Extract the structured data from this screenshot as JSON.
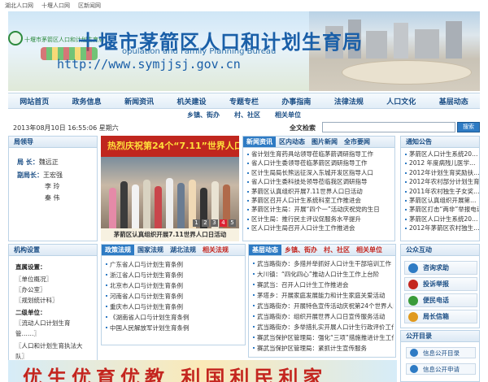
{
  "top_links": [
    "湖北人口网",
    "十堰人口网",
    "区新闻网"
  ],
  "banner": {
    "small_title": "十堰市茅箭区人口和计划生育局",
    "title": "十堰市茅箭区人口和计划生育局",
    "en_title": "opulation and Family Planning Bureau",
    "url": "http://www.symjjsj.gov.cn"
  },
  "nav": [
    "网站首页",
    "政务信息",
    "新闻资讯",
    "机关建设",
    "专题专栏",
    "办事指南",
    "法律法规",
    "人口文化",
    "基层动态"
  ],
  "subnav": [
    "乡镇、街办",
    "村、社区",
    "相关单位"
  ],
  "datebar": {
    "date": "2013年08月10日  16:55:06  星期六",
    "search_label": "全文检索",
    "search_value": "",
    "search_button": "搜索"
  },
  "leaders": {
    "heading": "局领导",
    "rows": [
      {
        "role": "局    长：",
        "name": "魏远正"
      },
      {
        "role": "副局长：",
        "name": "王宏强"
      },
      {
        "role": "",
        "name": "李    玲"
      },
      {
        "role": "",
        "name": "秦    伟"
      }
    ]
  },
  "institutions": {
    "heading": "机构设置",
    "lines": [
      "直属设置：",
      "〖单位概况〗",
      "〖办公室〗",
      "〖规划统计科〗",
      "二级单位：",
      "〖流动人口计划生育",
      "管……〗",
      "〖人口和计划生育执法大",
      "队〗"
    ]
  },
  "photo": {
    "banner_text": "热烈庆祝第24个“7.11”世界人口日",
    "caption": "茅箭区认真组织开展7.11世界人口日活动",
    "dots": [
      "1",
      "2",
      "3",
      "4",
      "5"
    ]
  },
  "news": {
    "tabs": [
      "新闻资讯",
      "区内动态",
      "图片新闻",
      "全市要闻"
    ],
    "items": [
      "省计划生育药具站领导莅临茅箭调研指导工作",
      "省人口计生委领导莅临茅箭区调研指导工作",
      "区计生局局长熊远征深入东城开发区指导人口",
      "省人口计生委科技处领导莅临我区调研指导",
      "茅箭区认真组织开展7.11世界人口日活动",
      "茅箭区召开人口计生系统科室工作推进会",
      "茅箭区计生局：开展“四个一”活动庆祝党的生日",
      "区计生局：推行民主评议促服务水平提升",
      "区人口计生局召开人口计生工作推进会"
    ]
  },
  "notice": {
    "heading": "通知公告",
    "items": [
      "茅箭区人口计生系统20…",
      "2012 年度病残儿医学…",
      "2012年计划生育奖励扶…",
      "2012年农村部分计划生育…",
      "2011年农村独生子女奖…",
      "茅箭区认真组织开展第…",
      "茅箭区打击“两非”举报电话",
      "茅箭区人口计生系统20…",
      "2012年茅箭区农村独生…"
    ]
  },
  "laws": {
    "tabs": [
      "政策法规",
      "国家法规",
      "湖北法规",
      "相关法规"
    ],
    "items": [
      "广东省人口与计划生育条例",
      "浙江省人口与计划生育条例",
      "北京市人口与计划生育条例",
      "河南省人口与计划生育条例",
      "重庆市人口与计划生育条例",
      "《湖南省人口与计划生育条例",
      "中国人民解放军计划生育条例"
    ]
  },
  "local": {
    "tabs": [
      "基层动态",
      "乡镇、街办",
      "村、社区",
      "相关单位"
    ],
    "items": [
      "武当路街办：多措并举抓好人口计生干部培训工作",
      "大川镇：“四化四心”推动人口计生工作上台阶",
      "赛武当：召开人口计生工作推进会",
      "茅塔乡：开展家庭发展能力和计生家庭关爱活动",
      "武当路街办：开展特色宣传活动庆祝第24个世界人口日",
      "武当路街办：组织开展世界人口日宣传服务活动",
      "武当路街办：多举措扎实开展人口计生行政评价工作",
      "赛武当保护区管理局：强化“三项”措施推进计生工作",
      "赛武当保护区管理局：紧抓计生宣传服务"
    ]
  },
  "service": {
    "heading": "公众互动",
    "items": [
      {
        "label": "咨询求助",
        "color": "#2e7bc4"
      },
      {
        "label": "投诉举报",
        "color": "#c4261f"
      },
      {
        "label": "便民电话",
        "color": "#3a9b3a"
      },
      {
        "label": "局长信箱",
        "color": "#e09a1f"
      }
    ]
  },
  "opengov": {
    "heading": "公开目录",
    "items": [
      "信息公开目录",
      "信息公开申请"
    ]
  },
  "slogan": "优生优育优教 利国利民利家"
}
